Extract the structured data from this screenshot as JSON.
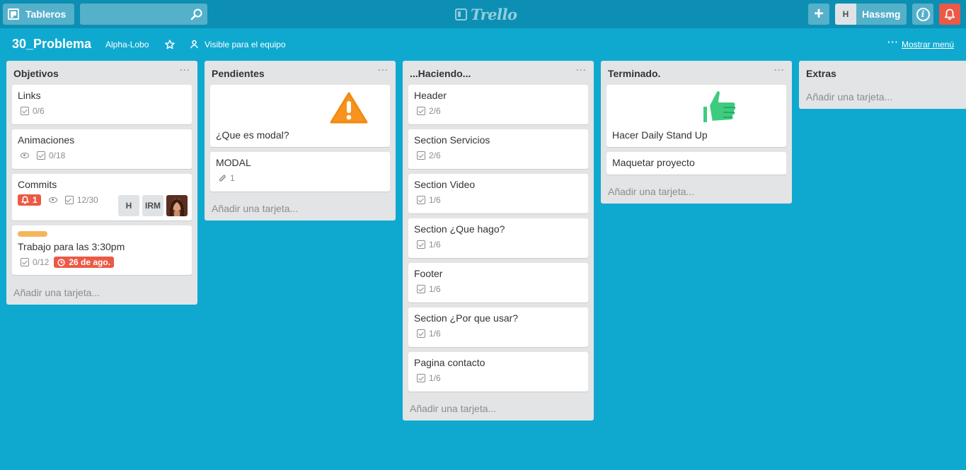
{
  "header": {
    "boards_label": "Tableros",
    "search_placeholder": "",
    "logo_text": "Trello",
    "member_initial": "H",
    "member_name": "Hassmg",
    "plus_label": "+",
    "info_label": "i"
  },
  "board": {
    "title": "30_Problema",
    "team": "Alpha-Lobo",
    "visibility": "Visible para el equipo",
    "menu_dots": "···",
    "menu_label": "Mostrar menú"
  },
  "lists": [
    {
      "title": "Objetivos",
      "more": "···",
      "add_label": "Añadir una tarjeta...",
      "cards": [
        {
          "title": "Links",
          "checklist": "0/6"
        },
        {
          "title": "Animaciones",
          "checklist": "0/18"
        },
        {
          "title": "Commits",
          "notifications": "1",
          "checklist": "12/30",
          "members": [
            "H",
            "IRM"
          ]
        },
        {
          "title": "Trabajo para las 3:30pm",
          "label_color": "#f5b65a",
          "checklist": "0/12",
          "due": "26 de ago."
        }
      ]
    },
    {
      "title": "Pendientes",
      "more": "···",
      "add_label": "Añadir una tarjeta...",
      "cards": [
        {
          "title": "¿Que es modal?",
          "sticker": "warning"
        },
        {
          "title": "MODAL",
          "attachments": "1"
        }
      ]
    },
    {
      "title": "...Haciendo...",
      "more": "···",
      "add_label": "Añadir una tarjeta...",
      "cards": [
        {
          "title": "Header",
          "checklist": "2/6"
        },
        {
          "title": "Section Servicios",
          "checklist": "2/6"
        },
        {
          "title": "Section Video",
          "checklist": "1/6"
        },
        {
          "title": "Section ¿Que hago?",
          "checklist": "1/6"
        },
        {
          "title": "Footer",
          "checklist": "1/6"
        },
        {
          "title": "Section ¿Por que usar?",
          "checklist": "1/6"
        },
        {
          "title": "Pagina contacto",
          "checklist": "1/6"
        }
      ]
    },
    {
      "title": "Terminado.",
      "more": "···",
      "add_label": "Añadir una tarjeta...",
      "cards": [
        {
          "title": "Hacer Daily Stand Up",
          "sticker": "thumbs-up"
        },
        {
          "title": "Maquetar proyecto"
        }
      ]
    },
    {
      "title": "Extras",
      "add_label": "Añadir una tarjeta..."
    }
  ],
  "colors": {
    "board_bg": "#0fa9d0",
    "header_bg": "#0c8fb3",
    "list_bg": "#e2e4e6",
    "danger": "#eb5a46",
    "label_orange": "#f5b65a",
    "sticker_green": "#3dcc7e",
    "sticker_orange": "#f7931e"
  }
}
